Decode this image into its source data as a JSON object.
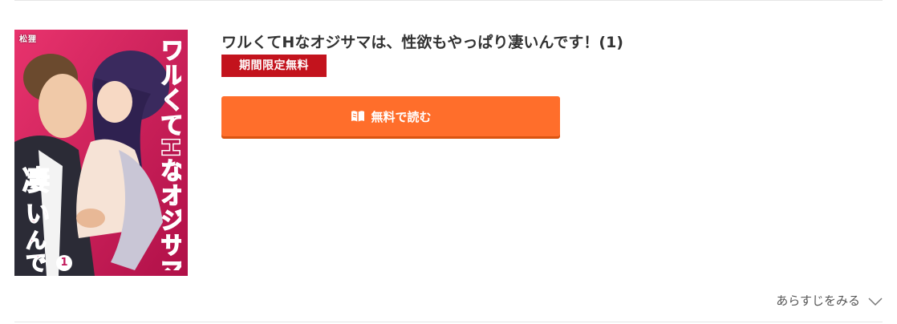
{
  "cover": {
    "author": "松狸",
    "title_art": "ワルくてHなオジサマは、性欲もやっぱり凄いんです!",
    "volume": "1"
  },
  "comic": {
    "title": "ワルくてHなオジサマは、性欲もやっぱり凄いんです！(1)",
    "badge": "期間限定無料"
  },
  "actions": {
    "read_button": "無料で読む",
    "synopsis_toggle": "あらすじをみる"
  },
  "colors": {
    "badge": "#c3131d",
    "button": "#ff6e2b",
    "cover_bg": "#d81b60"
  },
  "icons": {
    "read_button_icon": "book-open-icon",
    "synopsis_toggle_icon": "chevron-down-icon"
  }
}
